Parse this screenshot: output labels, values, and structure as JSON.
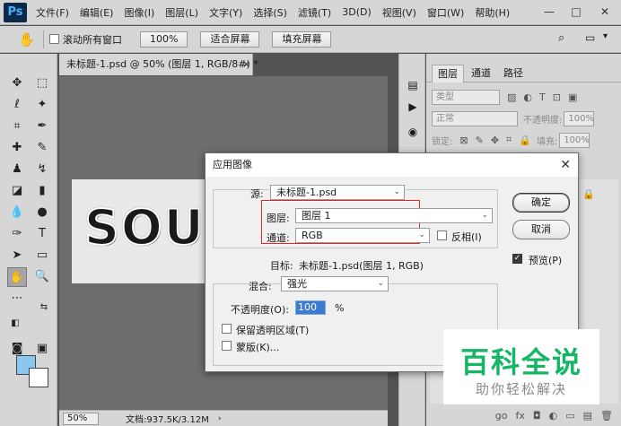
{
  "app": {
    "logo": "Ps"
  },
  "menu": [
    "文件(F)",
    "编辑(E)",
    "图像(I)",
    "图层(L)",
    "文字(Y)",
    "选择(S)",
    "滤镜(T)",
    "3D(D)",
    "视图(V)",
    "窗口(W)",
    "帮助(H)"
  ],
  "window_controls": {
    "minimize": "—",
    "restore": "□",
    "close": "✕"
  },
  "options": {
    "scroll_all_label": "滚动所有窗口",
    "zoom_value": "100%",
    "fit_screen_label": "适合屏幕",
    "fill_screen_label": "填充屏幕"
  },
  "document": {
    "tab_title": "未标题-1.psd @ 50% (图层 1, RGB/8#) *",
    "tab_close": "×",
    "canvas_text": "SOU",
    "zoom": "50%",
    "info": "文档:937.5K/3.12M"
  },
  "layers_panel": {
    "tabs": [
      "图层",
      "通道",
      "路径"
    ],
    "filter_label": "类型",
    "blend_mode": "正常",
    "opacity_label": "不透明度:",
    "opacity_value": "100%",
    "lock_label": "锁定:",
    "fill_label": "填充:",
    "fill_value": "100%",
    "bottom_icons": [
      "go",
      "fx",
      "◘",
      "◐",
      "▭",
      "▤",
      "🗑"
    ]
  },
  "dialog": {
    "title": "应用图像",
    "close": "✕",
    "source_label": "源:",
    "source_value": "未标题-1.psd",
    "layer_label": "图层:",
    "layer_value": "图层 1",
    "channel_label": "通道:",
    "channel_value": "RGB",
    "invert_label": "反相(I)",
    "target_label": "目标:",
    "target_value": "未标题-1.psd(图层 1, RGB)",
    "blend_label": "混合:",
    "blend_value": "强光",
    "opacity_label": "不透明度(O):",
    "opacity_value": "100",
    "opacity_unit": "%",
    "preserve_label": "保留透明区域(T)",
    "mask_label": "蒙版(K)...",
    "ok_label": "确定",
    "cancel_label": "取消",
    "preview_label": "预览(P)",
    "preview_checked": true
  },
  "watermark": {
    "title": "百科全说",
    "subtitle": "助你轻松解决"
  },
  "colors": {
    "foreground": "#8ac8f2",
    "background": "#ffffff",
    "highlight_box": "#d92b2b",
    "watermark_green": "#17b566"
  }
}
